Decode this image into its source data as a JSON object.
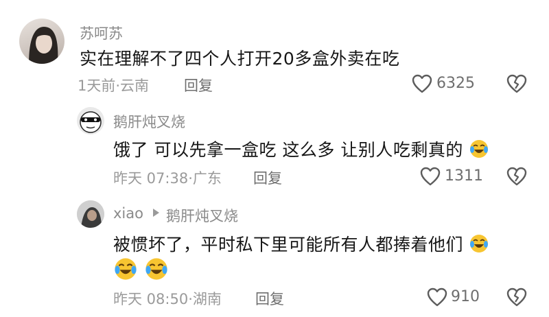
{
  "comments": [
    {
      "username": "苏呵苏",
      "text": "实在理解不了四个人打开20多盒外卖在吃",
      "time_location": "1天前·云南",
      "reply_label": "回复",
      "likes": "6325"
    },
    {
      "username": "鹅肝炖叉烧",
      "text": "饿了 可以先拿一盒吃 这么多 让别人吃剩真的",
      "time_location": "昨天 07:38·广东",
      "reply_label": "回复",
      "likes": "1311"
    },
    {
      "username": "xiao",
      "reply_to": "鹅肝炖叉烧",
      "text": "被惯坏了，平时私下里可能所有人都捧着他们",
      "time_location": "昨天 08:50·湖南",
      "reply_label": "回复",
      "likes": "910"
    }
  ],
  "icons": {
    "like": "heart-outline-icon",
    "dislike": "broken-heart-icon",
    "emoji": "tears-of-joy-emoji-icon",
    "reply_arrow": "play-triangle-icon"
  },
  "colors": {
    "text": "#161616",
    "meta": "#9a9a9a",
    "emoji_face": "#f7c531"
  }
}
